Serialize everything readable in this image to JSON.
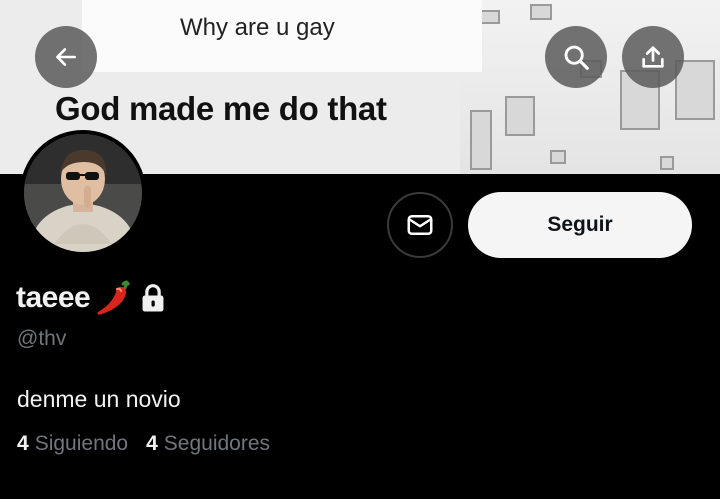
{
  "banner": {
    "meme_top_text": "Why are u gay",
    "meme_bottom_text": "God made me do that"
  },
  "header": {
    "back_icon": "arrow-left-icon",
    "search_icon": "search-icon",
    "share_icon": "share-icon"
  },
  "profile": {
    "display_name": "taeee",
    "name_emoji": "chili-pepper",
    "lock_icon": "lock-icon",
    "handle": "@thv",
    "bio": "denme un novio",
    "following_count": "4",
    "following_label": "Siguiendo",
    "followers_count": "4",
    "followers_label": "Seguidores"
  },
  "actions": {
    "message_icon": "mail-icon",
    "follow_label": "Seguir"
  }
}
